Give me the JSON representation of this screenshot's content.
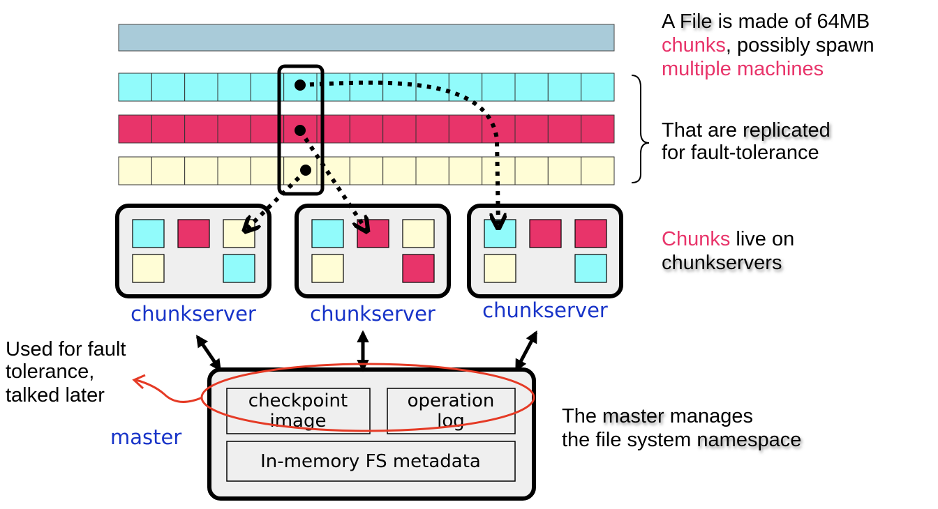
{
  "colors": {
    "file_bar": "#a9cbd9",
    "cyan": "#91fbfb",
    "red": "#e8346a",
    "yellow": "#fffdd6",
    "pink_text": "#e8346a",
    "blue_text": "#1733c8",
    "server_bg": "#efefef"
  },
  "replica_rows": [
    "cyan",
    "red",
    "yellow"
  ],
  "chunks_per_row": 15,
  "chunkservers": [
    {
      "label": "chunkserver",
      "chunks": [
        [
          "cyan",
          "red",
          "yellow"
        ],
        [
          "yellow",
          null,
          "cyan"
        ]
      ]
    },
    {
      "label": "chunkserver",
      "chunks": [
        [
          "cyan",
          "red",
          "yellow"
        ],
        [
          "yellow",
          null,
          "red"
        ]
      ]
    },
    {
      "label": "chunkserver",
      "chunks": [
        [
          "cyan",
          "red",
          "red"
        ],
        [
          "yellow",
          null,
          "cyan"
        ]
      ]
    }
  ],
  "master": {
    "label": "master",
    "checkpoint_1": "checkpoint",
    "checkpoint_2": "image",
    "oplog_1": "operation",
    "oplog_2": "log",
    "metadata": "In-memory FS metadata"
  },
  "notes": {
    "file": {
      "a": "A ",
      "file": "File",
      "rest": " is made of 64MB",
      "chunks": "chunks",
      "line2_rest": ", possibly spawn",
      "line3": "multiple machines"
    },
    "replicated": {
      "a": "That are ",
      "replicated": "replicated",
      "line2": "for fault-tolerance"
    },
    "chunks_live": {
      "chunks": "Chunks",
      "rest": " live on",
      "chunkservers": "chunkservers"
    },
    "master": {
      "a": "The ",
      "master": "master",
      "rest": " manages",
      "line2": "the file system ",
      "namespace": "namespace"
    },
    "fault": {
      "line1": "Used for fault",
      "line2": "tolerance,",
      "line3": "talked later"
    }
  }
}
